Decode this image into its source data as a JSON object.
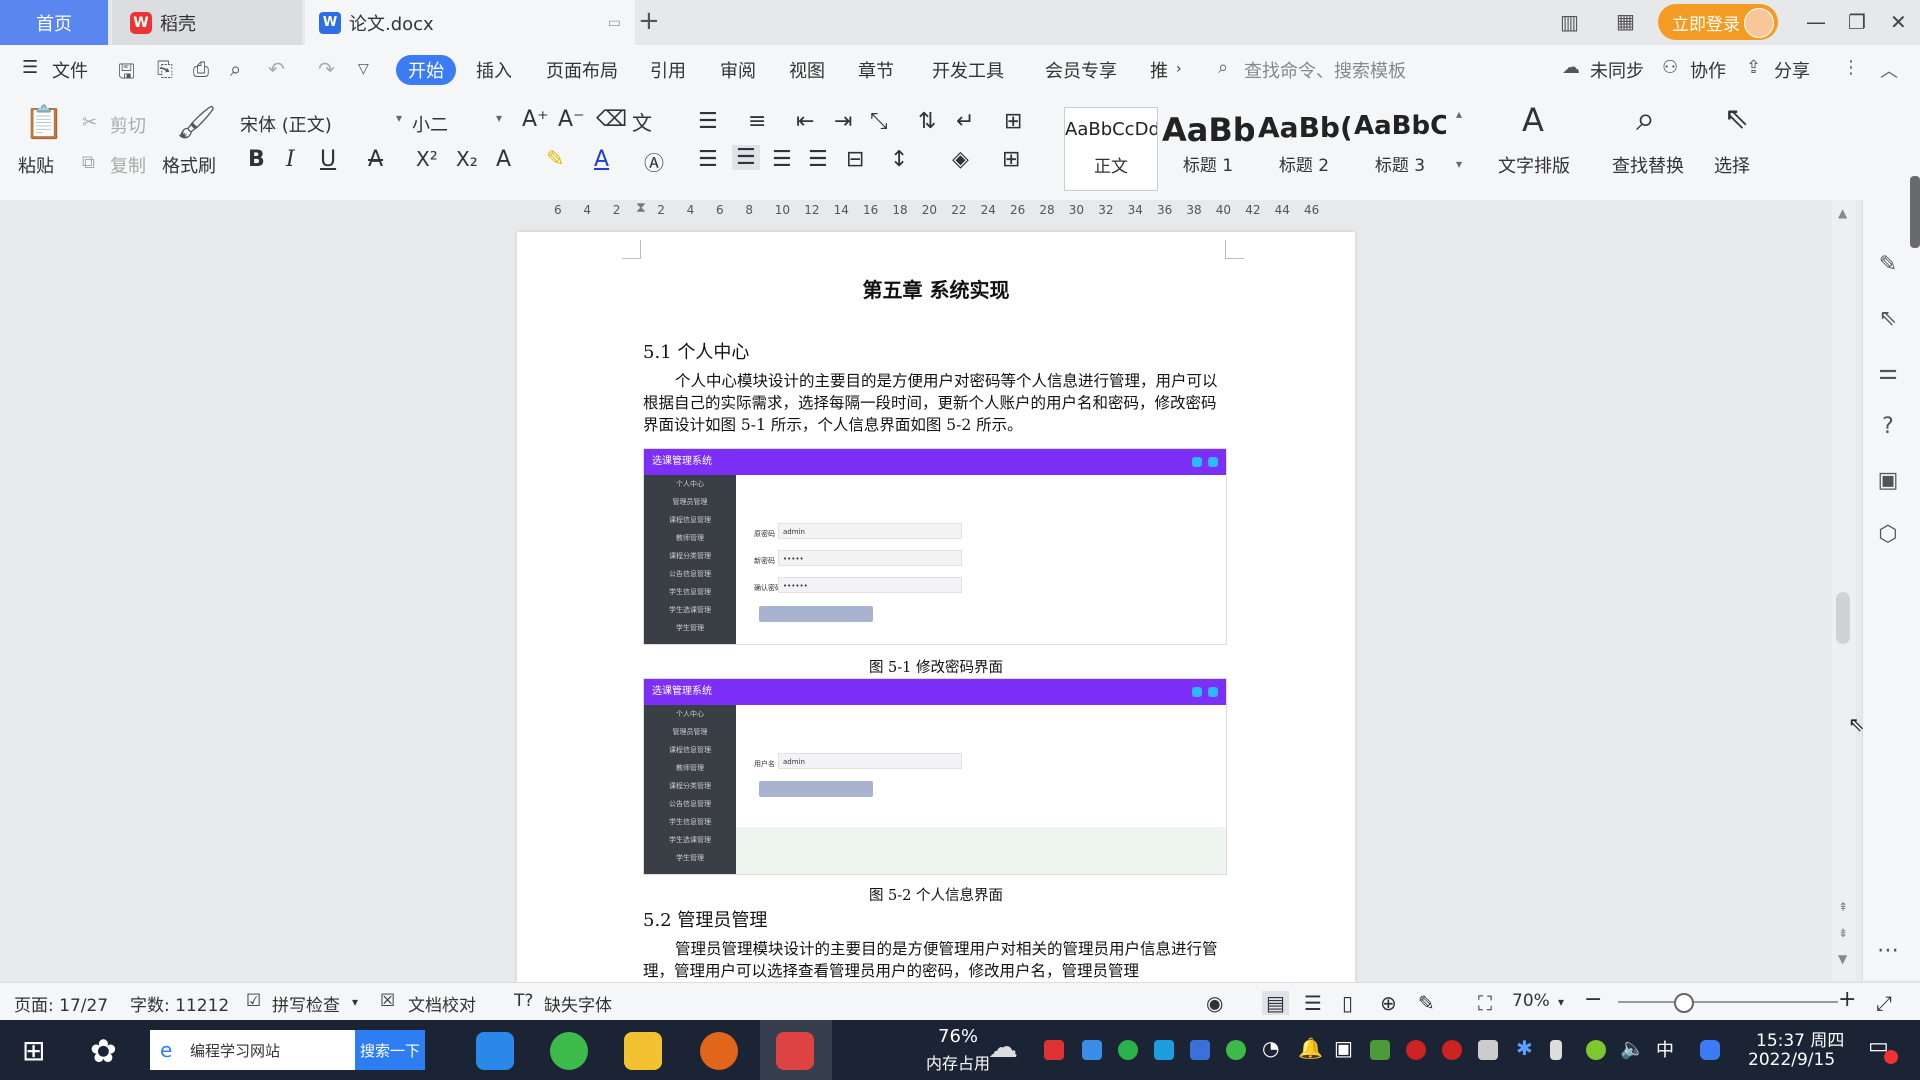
{
  "tabs": {
    "home": "首页",
    "daoke": "稻壳",
    "doc": "论文.docx",
    "new_tab": "+"
  },
  "header_right": {
    "login": "立即登录"
  },
  "menu": {
    "file": "文件",
    "start": "开始",
    "insert": "插入",
    "layout": "页面布局",
    "references": "引用",
    "review": "审阅",
    "view": "视图",
    "chapter": "章节",
    "devtools": "开发工具",
    "member": "会员专享",
    "recommend": "推",
    "search_placeholder": "查找命令、搜索模板",
    "unsynced": "未同步",
    "collab": "协作",
    "share": "分享"
  },
  "ribbon": {
    "paste": "粘贴",
    "cut": "剪切",
    "copy": "复制",
    "format_painter": "格式刷",
    "font_name": "宋体 (正文)",
    "font_size": "小二",
    "styles": [
      {
        "sample": "AaBbCcDd",
        "label": "正文"
      },
      {
        "sample": "AaBb",
        "label": "标题 1"
      },
      {
        "sample": "AaBb(",
        "label": "标题 2"
      },
      {
        "sample": "AaBbC",
        "label": "标题 3"
      }
    ],
    "text_layout": "文字排版",
    "find_replace": "查找替换",
    "select": "选择"
  },
  "ruler": {
    "ticks": [
      "6",
      "4",
      "2",
      "2",
      "4",
      "6",
      "8",
      "10",
      "12",
      "14",
      "16",
      "18",
      "20",
      "22",
      "24",
      "26",
      "28",
      "30",
      "32",
      "34",
      "36",
      "38",
      "40",
      "42",
      "44",
      "46"
    ]
  },
  "document": {
    "chapter_title": "第五章  系统实现",
    "section1_title": "5.1 个人中心",
    "section1_para": "个人中心模块设计的主要目的是方便用户对密码等个人信息进行管理，用户可以根据自己的实际需求，选择每隔一段时间，更新个人账户的用户名和密码，修改密码界面设计如图 5-1 所示，个人信息界面如图 5-2 所示。",
    "figure1": {
      "app_title": "选课管理系统",
      "sidebar": [
        "个人中心",
        "管理员管理",
        "课程信息管理",
        "教师管理",
        "课程分类管理",
        "公告信息管理",
        "学生信息管理",
        "学生选课管理",
        "学生管理"
      ],
      "fields": [
        {
          "label": "原密码",
          "value": "admin"
        },
        {
          "label": "新密码",
          "value": "•••••"
        },
        {
          "label": "确认密码",
          "value": "••••••"
        }
      ],
      "caption": "图 5-1 修改密码界面"
    },
    "figure2": {
      "app_title": "选课管理系统",
      "sidebar": [
        "个人中心",
        "管理员管理",
        "课程信息管理",
        "教师管理",
        "课程分类管理",
        "公告信息管理",
        "学生信息管理",
        "学生选课管理",
        "学生管理"
      ],
      "fields": [
        {
          "label": "用户名",
          "value": "admin"
        }
      ],
      "caption": "图 5-2 个人信息界面"
    },
    "section2_title": "5.2 管理员管理",
    "section2_para": "管理员管理模块设计的主要目的是方便管理用户对相关的管理员用户信息进行管理，管理用户可以选择查看管理员用户的密码，修改用户名，管理员管理"
  },
  "status": {
    "page": "页面: 17/27",
    "words": "字数: 11212",
    "spell_check": "拼写检查",
    "doc_check": "文档校对",
    "missing_font": "缺失字体",
    "zoom": "70%"
  },
  "taskbar": {
    "search_text": "编程学习网站",
    "search_button": "搜索一下",
    "memory_percent": "76%",
    "memory_label": "内存占用",
    "ime": "中",
    "time": "15:37 周四",
    "date": "2022/9/15"
  },
  "colors": {
    "accent": "#3b7cf5",
    "tab_home": "#5a86f0",
    "login": "#f39b22",
    "shot_header": "#7b2ff7",
    "taskbar": "#1b2435"
  }
}
